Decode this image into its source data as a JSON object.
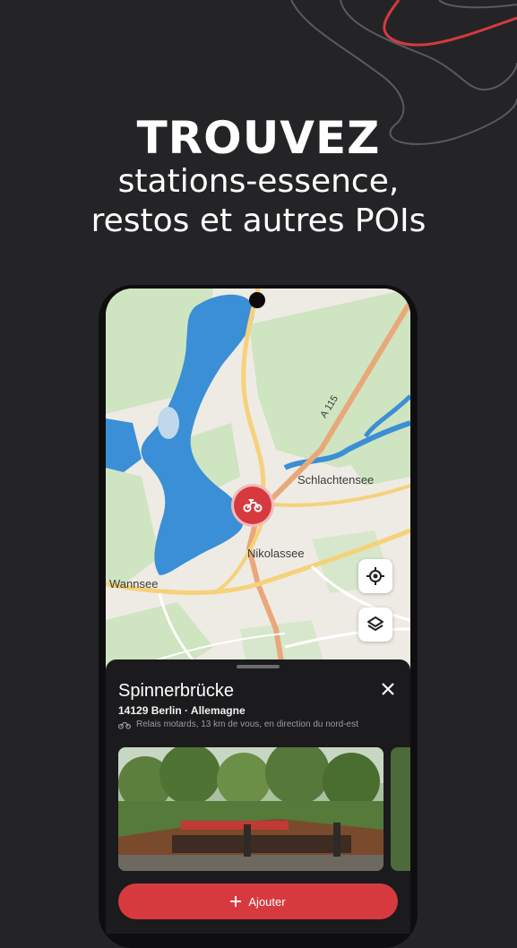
{
  "promo": {
    "headline": "TROUVEZ",
    "subline_1": "stations-essence,",
    "subline_2": "restos  et autres POIs"
  },
  "map": {
    "labels": {
      "road": "A 115",
      "schlachtensee": "Schlachtensee",
      "nikolassee": "Nikolassee",
      "wannsee": "Wannsee"
    },
    "controls": [
      "locate-icon",
      "layers-icon"
    ],
    "marker_icon": "motorcycle-icon"
  },
  "poi": {
    "title": "Spinnerbrücke",
    "address": "14129 Berlin · Allemagne",
    "meta": "Relais motards, 13 km de vous, en direction du nord-est",
    "meta_icon": "motorcycle-icon",
    "add_label": "Ajouter",
    "add_icon": "plus-icon",
    "close_icon": "close-icon"
  },
  "colors": {
    "background": "#242427",
    "accent": "#d63a3f",
    "sheet": "#1b1b1d",
    "water": "#3a8fd6",
    "park": "#cfe4c0"
  }
}
